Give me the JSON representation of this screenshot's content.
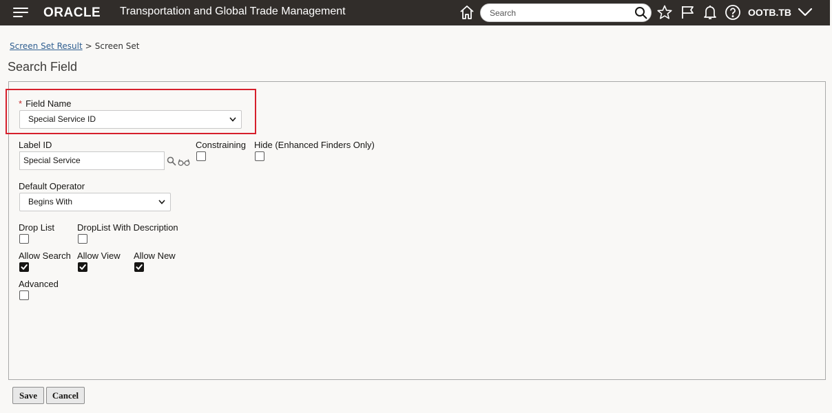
{
  "header": {
    "brand": "ORACLE",
    "app_title": "Transportation and Global Trade Management",
    "search_placeholder": "Search",
    "user": "OOTB.TB"
  },
  "breadcrumb": {
    "link": "Screen Set Result",
    "separator": ">",
    "current": "Screen Set"
  },
  "page_title": "Search Field",
  "form": {
    "field_name": {
      "label": "Field Name",
      "required_marker": "*",
      "value": "Special Service ID"
    },
    "label_id": {
      "label": "Label ID",
      "value": "Special Service"
    },
    "constraining": {
      "label": "Constraining",
      "checked": false
    },
    "hide": {
      "label": "Hide (Enhanced Finders Only)",
      "checked": false
    },
    "default_operator": {
      "label": "Default Operator",
      "value": "Begins With"
    },
    "drop_list": {
      "label": "Drop List",
      "checked": false
    },
    "droplist_desc": {
      "label": "DropList With Description",
      "checked": false
    },
    "allow_search": {
      "label": "Allow Search",
      "checked": true
    },
    "allow_view": {
      "label": "Allow View",
      "checked": true
    },
    "allow_new": {
      "label": "Allow New",
      "checked": true
    },
    "advanced": {
      "label": "Advanced",
      "checked": false
    }
  },
  "buttons": {
    "save": "Save",
    "cancel": "Cancel"
  },
  "colors": {
    "header_bg": "#312d2a",
    "highlight": "#d61f2b",
    "link": "#2f5e90"
  },
  "icons": [
    "menu-icon",
    "home-icon",
    "search-icon",
    "star-icon",
    "flag-icon",
    "bell-icon",
    "help-icon",
    "chevron-down-icon",
    "lookup-icon",
    "view-icon"
  ]
}
